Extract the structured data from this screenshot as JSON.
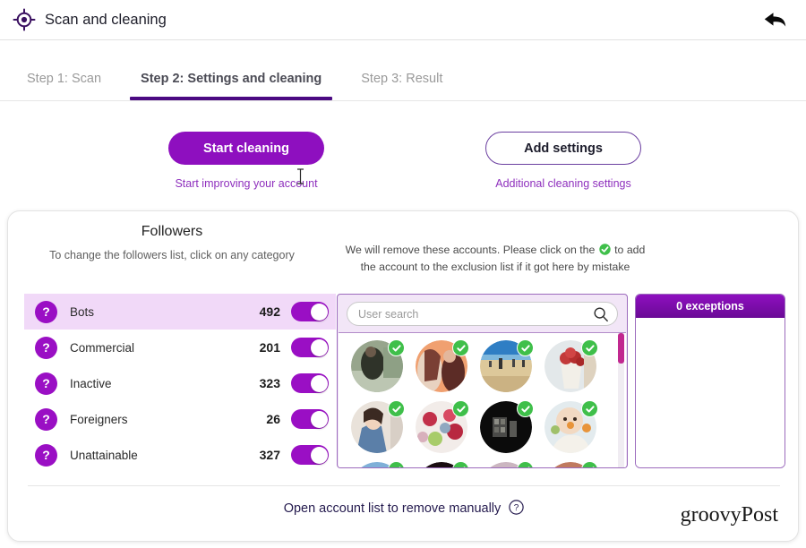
{
  "titlebar": {
    "icon": "crosshair-target-icon",
    "title": "Scan and cleaning",
    "back_icon": "back-arrow-icon"
  },
  "tabs": [
    {
      "label": "Step 1: Scan",
      "active": false
    },
    {
      "label": "Step 2: Settings and cleaning",
      "active": true
    },
    {
      "label": "Step 3: Result",
      "active": false
    }
  ],
  "actions": {
    "primary": {
      "label": "Start cleaning",
      "caption": "Start improving your account",
      "color": "#8e0fbf"
    },
    "secondary": {
      "label": "Add settings",
      "caption": "Additional cleaning settings",
      "color": "#6b3fa0"
    }
  },
  "followers": {
    "title": "Followers",
    "subtitle": "To change the followers list, click on any category",
    "categories": [
      {
        "icon": "question-mark-icon",
        "label": "Bots",
        "count": "492",
        "enabled": true,
        "highlighted": true
      },
      {
        "icon": "question-mark-icon",
        "label": "Commercial",
        "count": "201",
        "enabled": true,
        "highlighted": false
      },
      {
        "icon": "question-mark-icon",
        "label": "Inactive",
        "count": "323",
        "enabled": true,
        "highlighted": false
      },
      {
        "icon": "question-mark-icon",
        "label": "Foreigners",
        "count": "26",
        "enabled": true,
        "highlighted": false
      },
      {
        "icon": "question-mark-icon",
        "label": "Unattainable",
        "count": "327",
        "enabled": true,
        "highlighted": false
      }
    ]
  },
  "accounts": {
    "notice_line1_before": "We will remove these accounts. Please click on the",
    "notice_line1_after": "to add",
    "notice_line2": "the account to the exclusion list if it got here by mistake",
    "notice_icon": "green-check-icon",
    "search": {
      "placeholder": "User search",
      "value": "",
      "icon": "search-icon"
    },
    "avatars": [
      {
        "name": "account-avatar-1",
        "selected": true,
        "c1": "#6d7b66",
        "c2": "#2c2f28",
        "c3": "#b8c4b0"
      },
      {
        "name": "account-avatar-2",
        "selected": true,
        "c1": "#f0a070",
        "c2": "#7a3f34",
        "c3": "#e8d2c0"
      },
      {
        "name": "account-avatar-3",
        "selected": true,
        "c1": "#2f7ec4",
        "c2": "#e4d3a6",
        "c3": "#cdbb8c"
      },
      {
        "name": "account-avatar-4",
        "selected": true,
        "c1": "#d8dde0",
        "c2": "#c33a3a",
        "c3": "#e7d9c6"
      },
      {
        "name": "account-avatar-5",
        "selected": true,
        "c1": "#e8d6c6",
        "c2": "#3b4f6b",
        "c3": "#6d8ab0"
      },
      {
        "name": "account-avatar-6",
        "selected": true,
        "c1": "#efe4e0",
        "c2": "#c2304a",
        "c3": "#8fa8c0"
      },
      {
        "name": "account-avatar-7",
        "selected": true,
        "c1": "#0c0c0c",
        "c2": "#3a3a3a",
        "c3": "#151515"
      },
      {
        "name": "account-avatar-8",
        "selected": true,
        "c1": "#dfe7ea",
        "c2": "#e8943a",
        "c3": "#9fc06a"
      },
      {
        "name": "account-avatar-9",
        "selected": true,
        "c1": "#7fb0d8",
        "c2": "#3a5a80",
        "c3": "#c8dcec"
      },
      {
        "name": "account-avatar-10",
        "selected": true,
        "c1": "#2a1016",
        "c2": "#8b2a3a",
        "c3": "#120a0c"
      },
      {
        "name": "account-avatar-11",
        "selected": true,
        "c1": "#b89aa8",
        "c2": "#6a4a5a",
        "c3": "#d8c6cf"
      },
      {
        "name": "account-avatar-12",
        "selected": true,
        "c1": "#8c3a30",
        "c2": "#48201c",
        "c3": "#c07a60"
      }
    ],
    "scrollbar_color": "#c1288f"
  },
  "exceptions": {
    "header": "0 exceptions",
    "items": []
  },
  "footer": {
    "link_label": "Open account list to remove manually",
    "help_icon": "question-circle-icon",
    "brand": "groovyPost"
  }
}
